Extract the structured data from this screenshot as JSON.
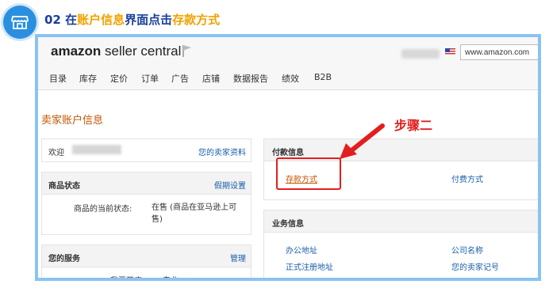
{
  "header": {
    "step_number": "02",
    "title_part1": "在",
    "title_part2": "账户信息",
    "title_part3": "界面点击",
    "title_part4": "存款方式"
  },
  "seller_central": {
    "logo_brand": "amazon",
    "logo_suffix": " seller central",
    "url": "www.amazon.com"
  },
  "nav": {
    "items": [
      "目录",
      "库存",
      "定价",
      "订单",
      "广告",
      "店铺",
      "数据报告",
      "绩效",
      "B2B"
    ]
  },
  "page": {
    "section_title": "卖家账户信息",
    "welcome_label": "欢迎",
    "seller_profile_link": "您的卖家资料",
    "product_status_title": "商品状态",
    "vacation_settings_link": "假期设置",
    "current_status_label": "商品的当前状态:",
    "current_status_value": "在售 (商品在亚马逊上可售)",
    "your_services_title": "您的服务",
    "manage_link": "管理",
    "service_row_label": "我要开店",
    "service_row_value": "专业",
    "payment_info_title": "付款信息",
    "deposit_method_link": "存款方式",
    "charge_method_link": "付费方式",
    "business_info_title": "业务信息",
    "office_address_link": "办公地址",
    "company_name_link": "公司名称",
    "registered_address_link": "正式注册地址",
    "seller_id_link": "您的卖家记号"
  },
  "annotation": {
    "step_label": "步骤二",
    "accent_color": "#e41e1e"
  },
  "colors": {
    "step_blue": "#1a3f9c",
    "step_highlight": "#f2a100",
    "frame_border": "#8ac3f3",
    "section_orange": "#c45500",
    "link_blue": "#1a5ea8"
  }
}
